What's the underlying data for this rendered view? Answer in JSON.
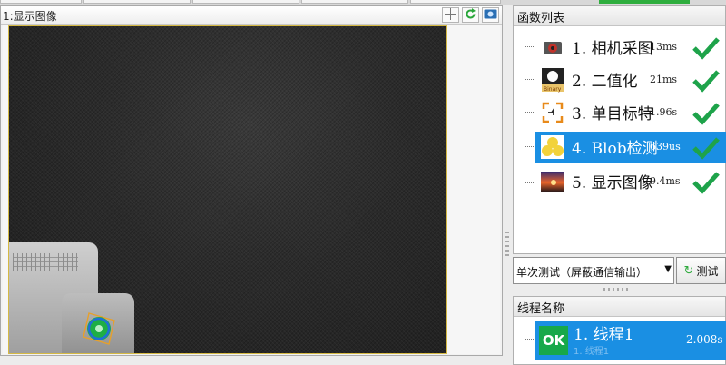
{
  "image_panel": {
    "title": "1:显示图像",
    "tools": [
      "crosshair-icon",
      "refresh-icon",
      "camera-icon"
    ]
  },
  "func_panel": {
    "title": "函数列表",
    "items": [
      {
        "label": "1. 相机采图",
        "time": "13ms",
        "icon": "camera-capture-icon",
        "status": "ok"
      },
      {
        "label": "2. 二值化",
        "time": "21ms",
        "icon": "binary-icon",
        "status": "ok"
      },
      {
        "label": "3. 单目标特",
        "time": "1.96s",
        "icon": "target-calib-icon",
        "status": "ok"
      },
      {
        "label": "4. Blob检测",
        "time": "639us",
        "icon": "blob-icon",
        "status": "ok",
        "selected": true
      },
      {
        "label": "5. 显示图像",
        "time": "9.4ms",
        "icon": "display-image-icon",
        "status": "ok"
      }
    ]
  },
  "test_bar": {
    "mode_value": "单次测试（屏蔽通信输出）",
    "test_label": "测试"
  },
  "thread_panel": {
    "title": "线程名称",
    "items": [
      {
        "badge": "OK",
        "name": "1. 线程1",
        "sub": "1. 线程1",
        "time": "2.008s"
      }
    ]
  },
  "colors": {
    "selection": "#1a8fe3",
    "ok_green": "#17a84a",
    "check_green": "#1ea34a",
    "frame_border": "#d5b944"
  }
}
